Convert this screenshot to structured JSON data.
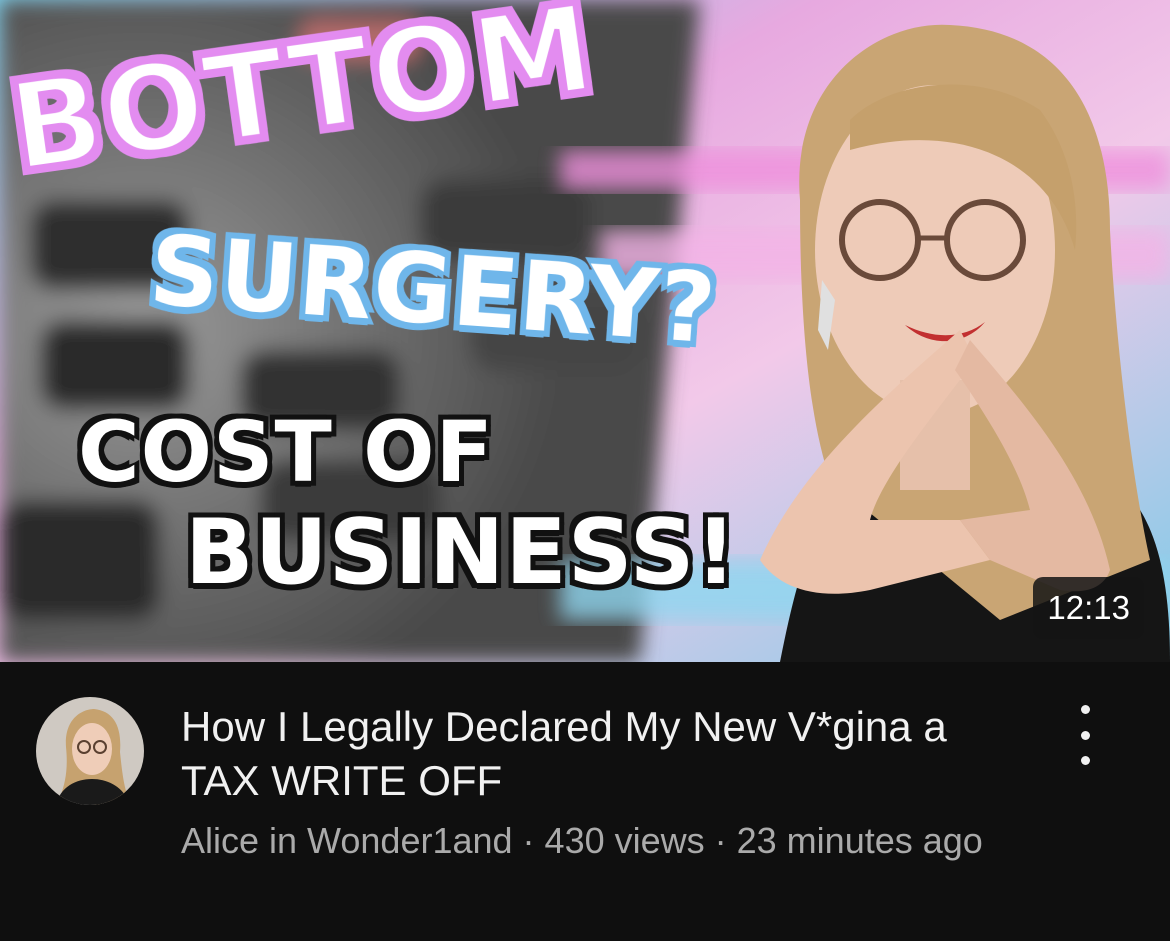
{
  "thumbnail": {
    "line1": "BOTTOM",
    "line2": "SURGERY?",
    "line3": "COST OF",
    "line4": "BUSINESS!",
    "duration": "12:13"
  },
  "video": {
    "title": "How I Legally Declared My New V*gina a TAX WRITE OFF",
    "channel": "Alice in Wonder1and",
    "separator": " · ",
    "views": "430 views",
    "age": "23 minutes ago"
  },
  "icons": {
    "more": "more-vert-icon",
    "avatar": "channel-avatar"
  },
  "colors": {
    "background": "#0f0f0f",
    "title_text": "#f1f1f1",
    "meta_text": "#aaaaaa",
    "pink_outline": "#e38cf0",
    "blue_outline": "#6fb6ea"
  }
}
